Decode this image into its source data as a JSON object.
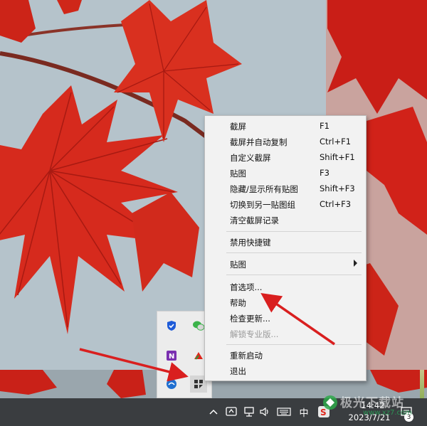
{
  "colors": {
    "menu_bg": "#f2f2f2",
    "taskbar_bg": "#3a3d40",
    "annotation_arrow": "#d91f1f",
    "leaf_red": "#d8271c"
  },
  "context_menu": {
    "items": [
      {
        "label": "截屏",
        "shortcut": "F1"
      },
      {
        "label": "截屏并自动复制",
        "shortcut": "Ctrl+F1"
      },
      {
        "label": "自定义截屏",
        "shortcut": "Shift+F1"
      },
      {
        "label": "贴图",
        "shortcut": "F3"
      },
      {
        "label": "隐藏/显示所有贴图",
        "shortcut": "Shift+F3"
      },
      {
        "label": "切换到另一贴图组",
        "shortcut": "Ctrl+F3"
      },
      {
        "label": "清空截屏记录",
        "shortcut": ""
      },
      {
        "label": "禁用快捷键",
        "shortcut": ""
      },
      {
        "label": "贴图",
        "shortcut": "",
        "submenu": true
      },
      {
        "label": "首选项...",
        "shortcut": ""
      },
      {
        "label": "帮助",
        "shortcut": ""
      },
      {
        "label": "检查更新...",
        "shortcut": ""
      },
      {
        "label": "解锁专业版...",
        "shortcut": "",
        "disabled": true
      },
      {
        "label": "重新启动",
        "shortcut": ""
      },
      {
        "label": "退出",
        "shortcut": ""
      }
    ]
  },
  "tray_popup": {
    "icons": [
      "shield-check-icon",
      "wechat-icon",
      "onenote-icon",
      "red-triangle-icon",
      "mail-icon",
      "snipaste-icon"
    ]
  },
  "taskbar": {
    "ime_label": "中",
    "clock_time": "14:42",
    "clock_date": "2023/7/21",
    "notification_count": "3",
    "icons": [
      "chevron-up-icon",
      "tray-app-icon",
      "network-icon",
      "volume-icon",
      "keyboard-icon",
      "sogou-input-icon",
      "notification-icon"
    ]
  },
  "watermark": {
    "text": "极光下载站",
    "url": "www.xz7.com"
  }
}
